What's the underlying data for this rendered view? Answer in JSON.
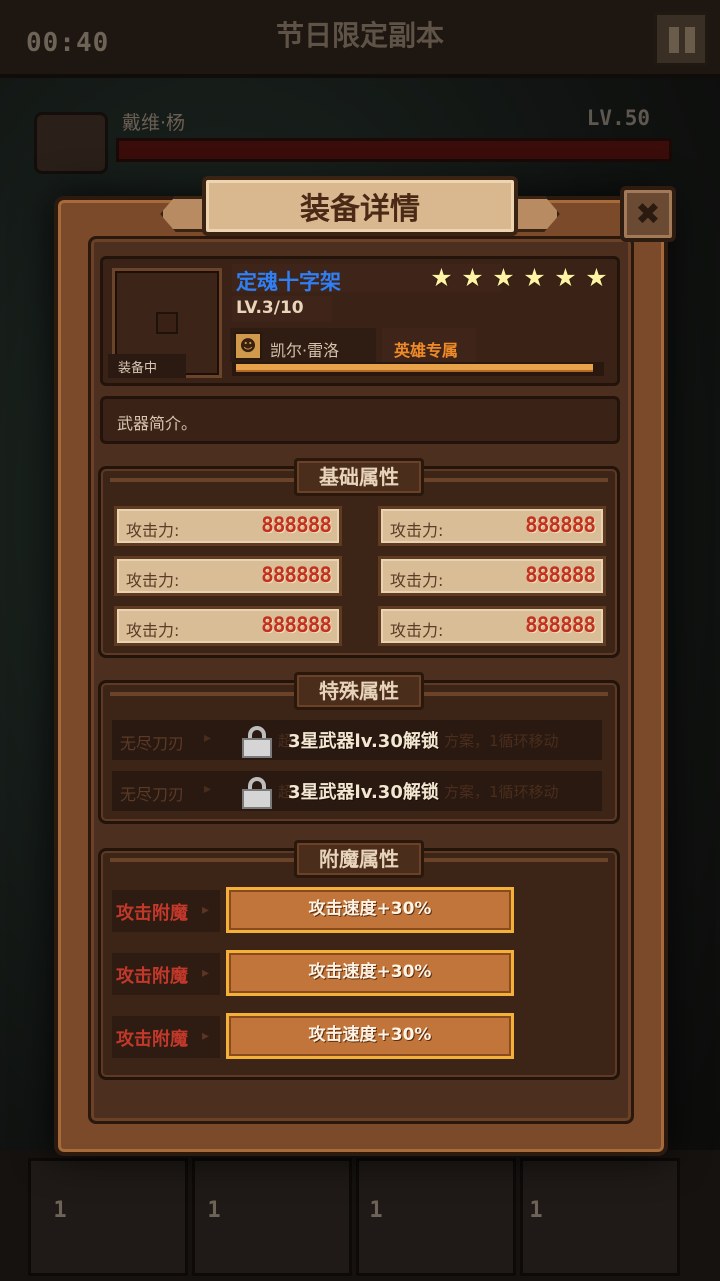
{
  "hud": {
    "timer": "00:40",
    "stage_title": "节日限定副本",
    "boss_name": "戴维·杨",
    "boss_level": "LV.50",
    "slot_numbers": [
      "1",
      "1",
      "1",
      "1"
    ]
  },
  "dialog": {
    "title": "装备详情",
    "close_icon": "close-icon"
  },
  "equipment": {
    "name": "定魂十字架",
    "stars": [
      "★",
      "★",
      "★",
      "★",
      "★",
      "★"
    ],
    "star_count": 6,
    "level": "LV.3/10",
    "equipped_tag": "装备中",
    "owner_name": "凯尔·雷洛",
    "exclusive_tag": "英雄专属",
    "progress_fraction": 0.98,
    "description": "武器简介。"
  },
  "sections": {
    "basic_title": "基础属性",
    "special_title": "特殊属性",
    "enchant_title": "附魔属性"
  },
  "basic_attrs": [
    {
      "label": "攻击力:",
      "value": "888888"
    },
    {
      "label": "攻击力:",
      "value": "888888"
    },
    {
      "label": "攻击力:",
      "value": "888888"
    },
    {
      "label": "攻击力:",
      "value": "888888"
    },
    {
      "label": "攻击力:",
      "value": "888888"
    },
    {
      "label": "攻击力:",
      "value": "888888"
    }
  ],
  "special_attrs": [
    {
      "label": "无尽刀刃",
      "bg_text": "超",
      "bg_text_tail": "方案，1循环移动",
      "unlock_text": "3星武器lv.30解锁"
    },
    {
      "label": "无尽刀刃",
      "bg_text": "超",
      "bg_text_tail": "方案，1循环移动",
      "unlock_text": "3星武器lv.30解锁"
    }
  ],
  "enchant_attrs": [
    {
      "label": "攻击附魔",
      "value": "攻击速度+30%"
    },
    {
      "label": "攻击附魔",
      "value": "攻击速度+30%"
    },
    {
      "label": "攻击附魔",
      "value": "攻击速度+30%"
    }
  ],
  "colors": {
    "item_name": "#2f7ff5",
    "exclusive": "#ef8a28",
    "attr_value": "#c2321f",
    "enchant_label": "#c2392b",
    "enchant_border": "#f4b13a"
  }
}
